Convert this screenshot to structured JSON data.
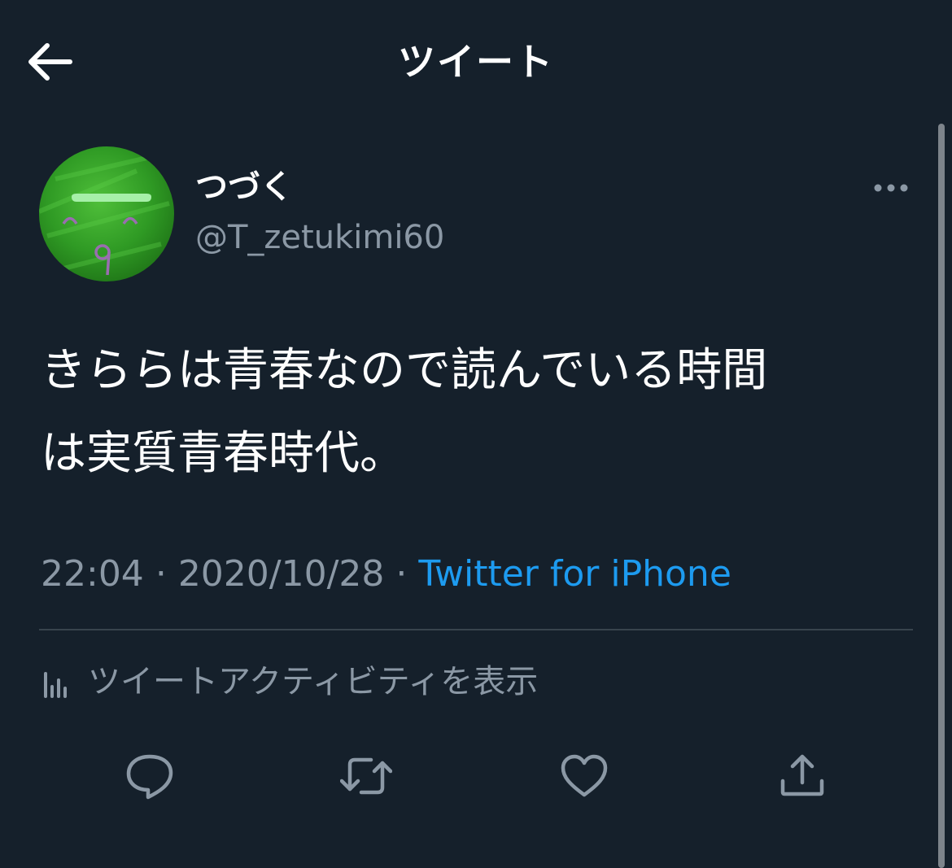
{
  "header": {
    "title": "ツイート",
    "back_icon": "arrow-left-icon"
  },
  "tweet": {
    "display_name": "つづく",
    "handle": "@T_zetukimi60",
    "text_line1": "きららは青春なので読んでいる時間",
    "text_line2": "は実質青春時代。",
    "time": "22:04",
    "separator": "·",
    "date": "2020/10/28",
    "source": "Twitter for iPhone"
  },
  "activity": {
    "label": "ツイートアクティビティを表示",
    "icon": "bar-chart-icon"
  },
  "actions": {
    "reply_icon": "reply-icon",
    "retweet_icon": "retweet-icon",
    "like_icon": "heart-icon",
    "share_icon": "share-icon"
  },
  "colors": {
    "background": "#15202b",
    "text_primary": "#ffffff",
    "text_secondary": "#8b98a5",
    "accent": "#1d9bf0",
    "divider": "#38444d"
  }
}
